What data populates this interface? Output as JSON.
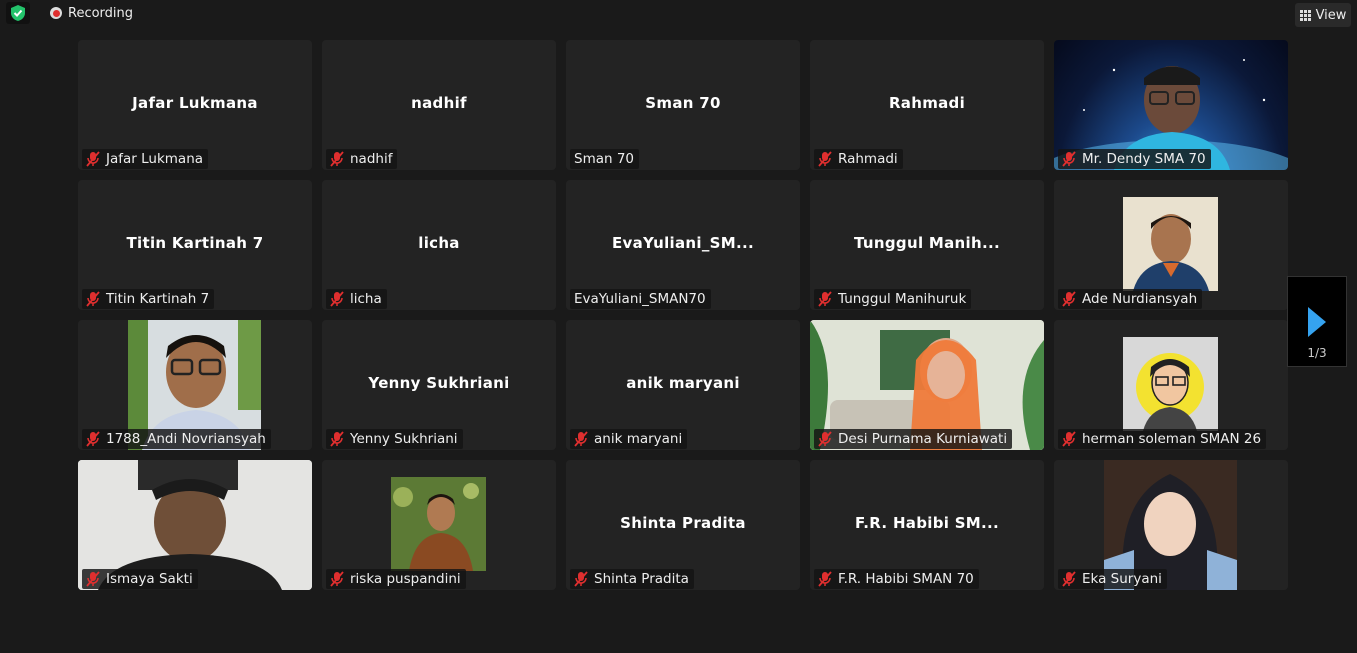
{
  "top": {
    "recording_label": "Recording",
    "view_label": "View"
  },
  "colors": {
    "mic_muted": "#e02f2f",
    "accent": "#35a3f0",
    "tile_bg": "#232323"
  },
  "pager": {
    "page": "1/3"
  },
  "participants": [
    {
      "name": "Jafar Lukmana",
      "tile_title": "Jafar Lukmana",
      "muted": true
    },
    {
      "name": "nadhif",
      "tile_title": "nadhif",
      "muted": true
    },
    {
      "name": "Sman 70",
      "tile_title": "Sman 70",
      "muted": false
    },
    {
      "name": "Rahmadi",
      "tile_title": "Rahmadi",
      "muted": true
    },
    {
      "name": "Mr. Dendy SMA 70",
      "tile_title": "",
      "muted": true
    },
    {
      "name": "Titin Kartinah 7",
      "tile_title": "Titin Kartinah 7",
      "muted": true
    },
    {
      "name": "licha",
      "tile_title": "licha",
      "muted": true
    },
    {
      "name": "EvaYuliani_SMAN70",
      "tile_title": "EvaYuliani_SM...",
      "muted": false
    },
    {
      "name": "Tunggul Manihuruk",
      "tile_title": "Tunggul Manih...",
      "muted": true
    },
    {
      "name": "Ade Nurdiansyah",
      "tile_title": "",
      "muted": true
    },
    {
      "name": "1788_Andi Novriansyah",
      "tile_title": "",
      "muted": true
    },
    {
      "name": "Yenny Sukhriani",
      "tile_title": "Yenny Sukhriani",
      "muted": true
    },
    {
      "name": "anik maryani",
      "tile_title": "anik maryani",
      "muted": true
    },
    {
      "name": "Desi Purnama Kurniawati",
      "tile_title": "",
      "muted": true
    },
    {
      "name": "herman soleman SMAN 26",
      "tile_title": "",
      "muted": true
    },
    {
      "name": "Ismaya Sakti",
      "tile_title": "",
      "muted": true
    },
    {
      "name": "riska puspandini",
      "tile_title": "",
      "muted": true
    },
    {
      "name": "Shinta Pradita",
      "tile_title": "Shinta Pradita",
      "muted": true
    },
    {
      "name": "F.R. Habibi SMAN 70",
      "tile_title": "F.R. Habibi SM...",
      "muted": true
    },
    {
      "name": "Eka Suryani",
      "tile_title": "",
      "muted": true
    }
  ]
}
